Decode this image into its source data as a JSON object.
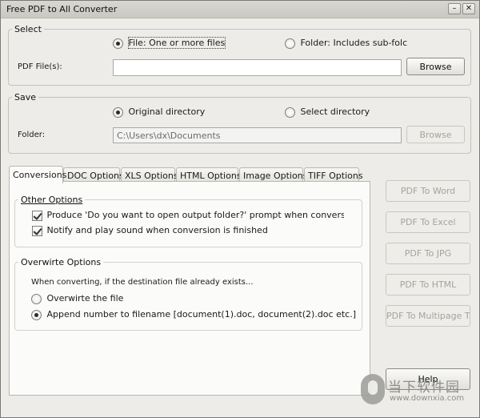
{
  "window": {
    "title": "Free PDF to All Converter",
    "minimize_glyph": "–",
    "close_glyph": "✕"
  },
  "select_group": {
    "legend": "Select",
    "radio_file_label": "File:  One or more files",
    "radio_file_checked": true,
    "radio_folder_label": "Folder: Includes sub-folc",
    "radio_folder_checked": false,
    "pdf_files_label": "PDF File(s):",
    "pdf_files_value": "",
    "browse_label": "Browse"
  },
  "save_group": {
    "legend": "Save",
    "radio_original_label": "Original directory",
    "radio_original_checked": true,
    "radio_select_label": "Select directory",
    "radio_select_checked": false,
    "folder_label": "Folder:",
    "folder_value": "C:\\Users\\dx\\Documents",
    "browse_label": "Browse",
    "browse_enabled": false
  },
  "tabs": [
    {
      "label": "Conversions",
      "active": true
    },
    {
      "label": "DOC Options",
      "active": false
    },
    {
      "label": "XLS Options",
      "active": false
    },
    {
      "label": "HTML Options",
      "active": false
    },
    {
      "label": "Image Options",
      "active": false
    },
    {
      "label": "TIFF Options",
      "active": false
    }
  ],
  "conversions": {
    "other_options": {
      "legend": "Other Options",
      "prompt_label": "Produce 'Do you want to open output folder?' prompt when conversion is finis",
      "prompt_checked": true,
      "notify_label": "Notify and play sound when conversion is finished",
      "notify_checked": true
    },
    "overwrite_options": {
      "legend": "Overwirte Options",
      "description": "When converting, if the destination file already exists...",
      "overwrite_label": "Overwirte the file",
      "overwrite_checked": false,
      "append_label": "Append number to filename  [document(1).doc, document(2).doc etc.]",
      "append_checked": true
    }
  },
  "actions": {
    "to_word": "PDF To Word",
    "to_excel": "PDF To Excel",
    "to_jpg": "PDF To JPG",
    "to_html": "PDF To HTML",
    "to_tiff": "PDF To Multipage TIFF",
    "help": "Help"
  },
  "watermark": {
    "logo_icon": "download-logo-icon",
    "text_cn": "当下软件园",
    "text_url": "www.downxia.com"
  }
}
